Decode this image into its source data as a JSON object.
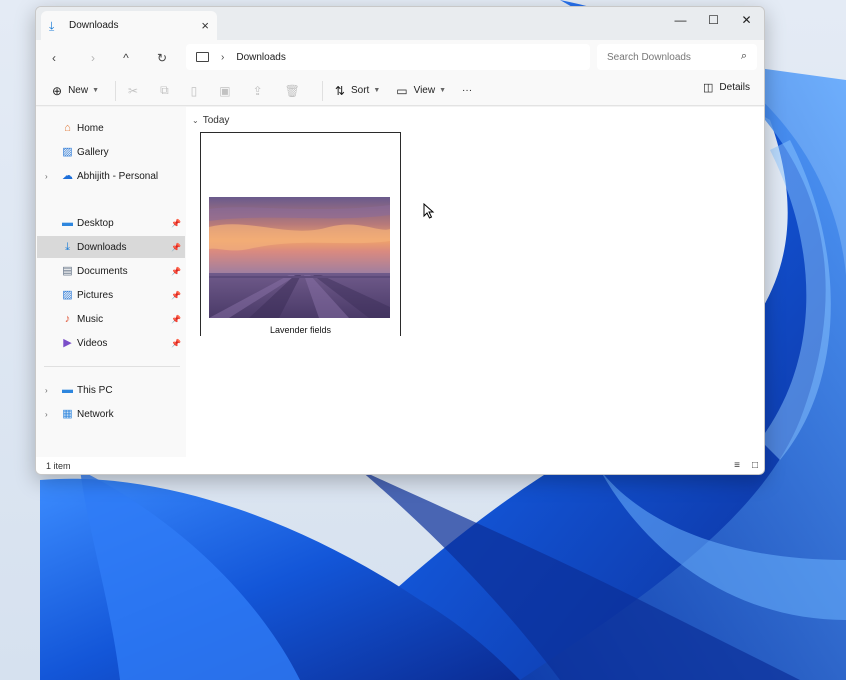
{
  "window": {
    "tab_title": "Downloads",
    "controls": {
      "minimize": "—",
      "maximize": "☐",
      "close": "✕"
    }
  },
  "navigation": {
    "back": "‹",
    "forward": "›",
    "up": "^",
    "refresh": "↻",
    "breadcrumb_separator": "›",
    "breadcrumb_location": "Downloads",
    "search_placeholder": "Search Downloads"
  },
  "toolbar": {
    "new_label": "New",
    "sort_label": "Sort",
    "view_label": "View",
    "more_label": "···",
    "details_label": "Details"
  },
  "sidebar": {
    "home": "Home",
    "gallery": "Gallery",
    "onedrive": "Abhijith - Personal",
    "desktop": "Desktop",
    "downloads": "Downloads",
    "documents": "Documents",
    "pictures": "Pictures",
    "music": "Music",
    "videos": "Videos",
    "this_pc": "This PC",
    "network": "Network"
  },
  "content": {
    "group_header": "Today",
    "files": [
      {
        "name": "Lavender fields"
      }
    ]
  },
  "status": {
    "item_count": "1 item"
  },
  "colors": {
    "accent": "#1a7bd6",
    "selected_nav": "#d9d9d9",
    "wallpaper_blue": "#1546c2"
  }
}
